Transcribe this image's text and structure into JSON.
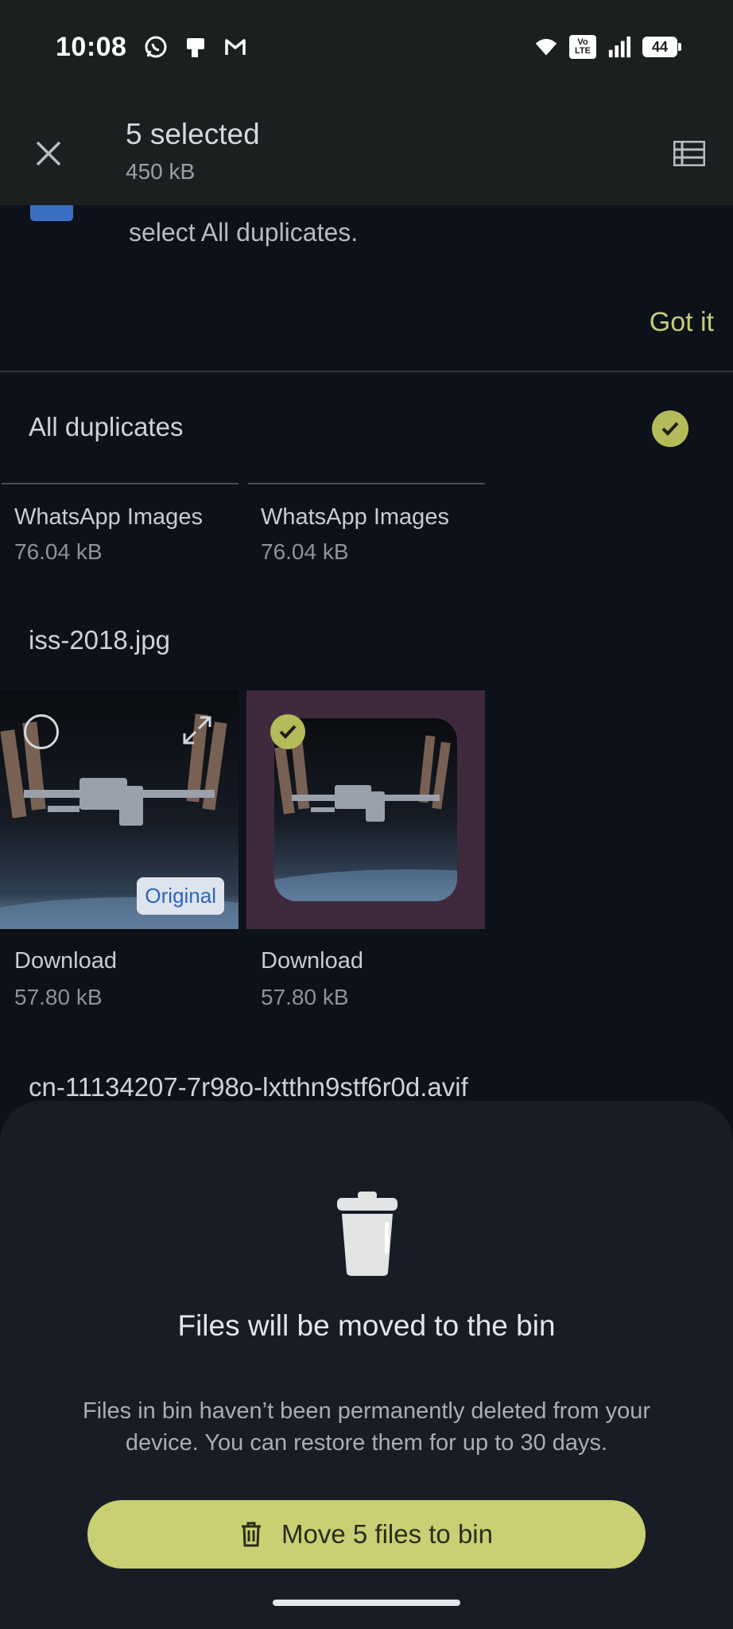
{
  "status_bar": {
    "time": "10:08",
    "left_icons": [
      "whatsapp-icon",
      "sim-card-icon",
      "gmail-icon"
    ],
    "right_icons": [
      "wifi-icon",
      "volte-icon",
      "signal-icon",
      "battery-icon"
    ],
    "volte_top": "Vo",
    "volte_bottom": "LTE",
    "battery": "44"
  },
  "app_bar": {
    "title": "5 selected",
    "subtitle": "450 kB"
  },
  "tip": {
    "text": "select All duplicates.",
    "action": "Got it"
  },
  "group": {
    "title": "All duplicates"
  },
  "whatsapp_files": [
    {
      "folder": "WhatsApp Images",
      "size": "76.04 kB"
    },
    {
      "folder": "WhatsApp Images",
      "size": "76.04 kB"
    }
  ],
  "iss_group": {
    "filename": "iss-2018.jpg",
    "original_badge": "Original",
    "files": [
      {
        "folder": "Download",
        "size": "57.80 kB"
      },
      {
        "folder": "Download",
        "size": "57.80 kB"
      }
    ]
  },
  "next_group": {
    "filename": "cn-11134207-7r98o-lxtthn9stf6r0d.avif"
  },
  "sheet": {
    "title": "Files will be moved to the bin",
    "body": "Files in bin haven’t been permanently deleted from your device. You can restore them for up to 30 days.",
    "button": "Move 5 files to bin"
  },
  "colors": {
    "accent": "#c9cf73",
    "check": "#b5ba5a",
    "background": "#0c111a",
    "sheet": "#181d25",
    "selected_tile": "#3f2a3d"
  }
}
